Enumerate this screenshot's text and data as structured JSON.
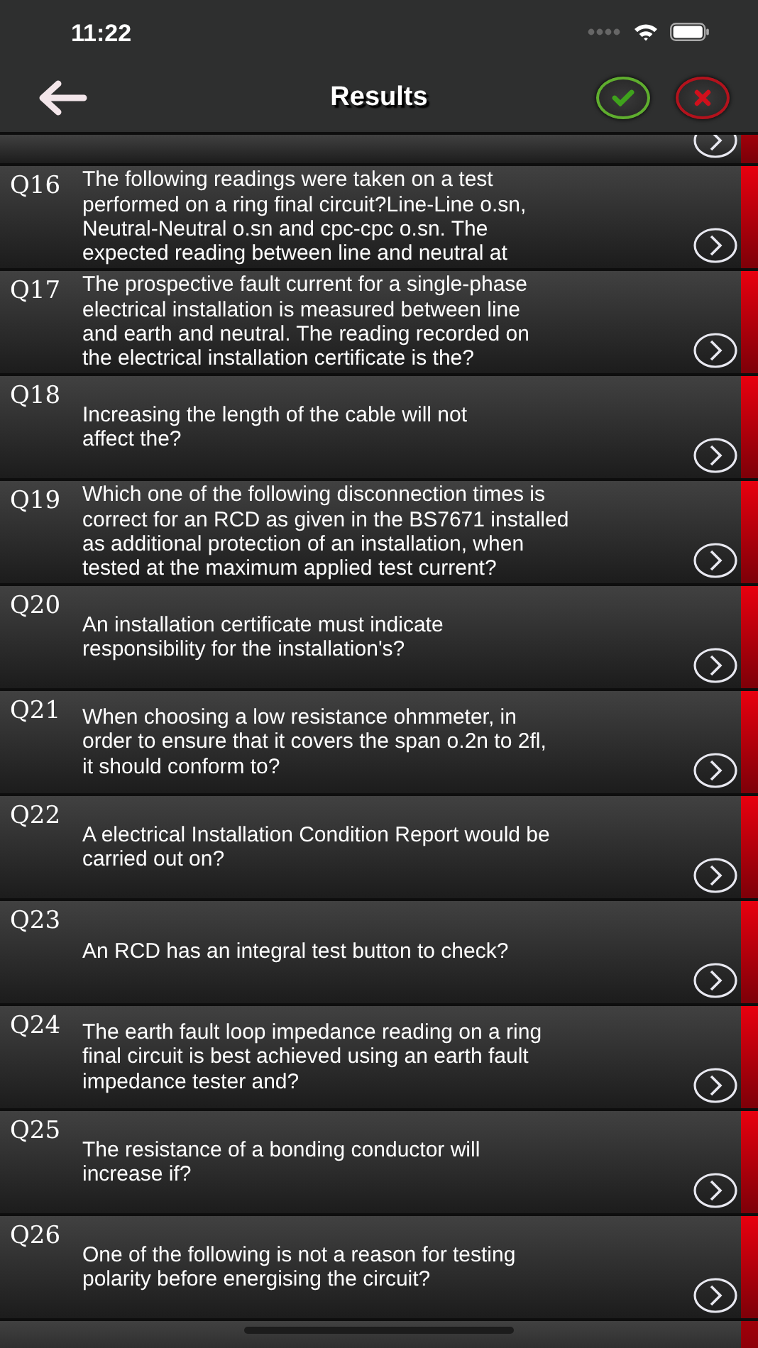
{
  "status_bar": {
    "time": "11:22"
  },
  "nav": {
    "title": "Results",
    "filters": [
      {
        "kind": "correct"
      },
      {
        "kind": "wrong"
      }
    ]
  },
  "questions": [
    {
      "number": "Q16",
      "text": "The following readings were taken on a test\nperformed on a ring final circuit?Line-Line o.sn,\nNeutral-Neutral o.sn and cpc-cpc o.sn. The\nexpected reading between line and neutral at",
      "correct": false
    },
    {
      "number": "Q17",
      "text": "The prospective fault current for a single-phase\nelectrical installation is measured between line\nand earth and neutral. The reading recorded on\nthe electrical installation certificate is the?",
      "correct": false
    },
    {
      "number": "Q18",
      "text": "Increasing the length of the cable will not\naffect the?",
      "correct": false
    },
    {
      "number": "Q19",
      "text": "Which one of the following disconnection times is\ncorrect for an RCD as given in the BS7671 installed\nas additional protection of an installation, when\ntested at the maximum applied test current?",
      "correct": false
    },
    {
      "number": "Q20",
      "text": "An installation certificate must indicate\nresponsibility for the installation's?",
      "correct": false
    },
    {
      "number": "Q21",
      "text": "When choosing a low resistance ohmmeter, in\norder to ensure that it covers the span o.2n to 2fl,\nit should conform to?",
      "correct": false
    },
    {
      "number": "Q22",
      "text": "A electrical Installation Condition Report would be\ncarried out on?",
      "correct": false
    },
    {
      "number": "Q23",
      "text": "An RCD has an integral test button to check?",
      "correct": false
    },
    {
      "number": "Q24",
      "text": "The earth fault loop impedance reading on a ring\nfinal circuit is best achieved using an earth fault\nimpedance tester and?",
      "correct": false
    },
    {
      "number": "Q25",
      "text": "The resistance of a bonding conductor will\nincrease if?",
      "correct": false
    },
    {
      "number": "Q26",
      "text": "One of the following is not a reason for testing\npolarity before energising the circuit?",
      "correct": false
    }
  ]
}
